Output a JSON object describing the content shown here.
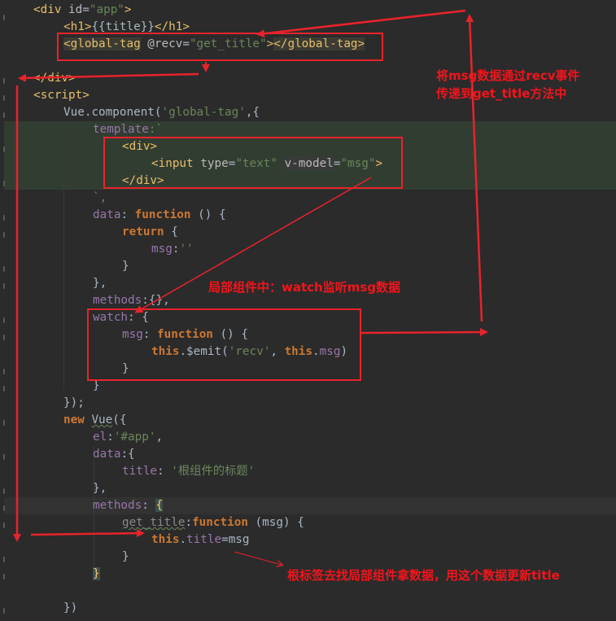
{
  "code": {
    "l1": {
      "open": "<div ",
      "attr": "id",
      "eq": "=",
      "val": "\"app\"",
      "close": ">"
    },
    "l2": {
      "open": "<h1>",
      "txt": "{{title}}",
      "close": "</h1>"
    },
    "l3": {
      "open": "<global-tag",
      "attr": " @recv",
      "eq": "=",
      "val": "\"get_title\"",
      "gt": ">",
      "close": "</global-tag>",
      "gt2": ">"
    },
    "l5": {
      "text": "</div>"
    },
    "l6": {
      "text": "<script>"
    },
    "l7": {
      "obj": "Vue",
      "dot": ".",
      "fn": "component",
      "open": "(",
      "str": "'global-tag'",
      "rest": ",{"
    },
    "l8": {
      "prop": "template",
      "rest": ":`"
    },
    "l9": {
      "tag": "<div>"
    },
    "l10": {
      "open": "<input ",
      "a1": "type",
      "eq1": "=",
      "v1": "\"text\"",
      "sp": " ",
      "a2": "v-model",
      "eq2": "=",
      "v2": "\"msg\"",
      "close": ">"
    },
    "l11": {
      "tag": "</div>"
    },
    "l12": {
      "text": "`,"
    },
    "l13": {
      "prop": "data",
      "colon": ": ",
      "kw": "function",
      "rest": " () {"
    },
    "l14": {
      "kw": "return",
      "rest": " {"
    },
    "l15": {
      "prop": "msg",
      "colon": ":",
      "str": "''"
    },
    "l16": {
      "text": "}"
    },
    "l17": {
      "text": "},"
    },
    "l18": {
      "prop": "methods",
      "rest": ":{},"
    },
    "l19": {
      "prop": "watch",
      "rest": ": {"
    },
    "l20": {
      "prop": "msg",
      "colon": ": ",
      "kw": "function",
      "rest": " () {"
    },
    "l21": {
      "kw1": "this",
      "dot": ".",
      "fn": "$emit",
      "open": "(",
      "str": "'recv'",
      "comma": ", ",
      "kw2": "this",
      "dot2": ".",
      "prop": "msg",
      "close": ")"
    },
    "l22": {
      "text": "}"
    },
    "l23": {
      "text": "}"
    },
    "l24": {
      "text": "});"
    },
    "l25": {
      "kw": "new",
      "sp": " ",
      "obj": "Vue",
      "rest": "({"
    },
    "l26": {
      "prop": "el",
      "colon": ":",
      "str": "'#app'",
      "rest": ","
    },
    "l27": {
      "prop": "data",
      "rest": ":{"
    },
    "l28": {
      "prop": "title",
      "colon": ": ",
      "str": "'根组件的标题'"
    },
    "l29": {
      "text": "},"
    },
    "l30": {
      "prop": "methods",
      "colon": ": ",
      "brace": "{"
    },
    "l31": {
      "fn": "get_title",
      "colon": ":",
      "kw": "function",
      "rest": " (msg) {"
    },
    "l32": {
      "kw": "this",
      "dot": ".",
      "prop": "title",
      "rest": "=msg"
    },
    "l33": {
      "text": "}"
    },
    "l34": {
      "brace": "}"
    },
    "l36": {
      "text": "})"
    }
  },
  "annotations": {
    "a1_line1": "将msg数据通过recv事件",
    "a1_line2": "传递到get_title方法中",
    "a2": "局部组件中：watch监听msg数据",
    "a3": "根标签去找局部组件拿数据，用这个数据更新title"
  },
  "colors": {
    "background": "#2b2b2b",
    "annotation_red": "#e8232b",
    "tag": "#e8bf6a",
    "string": "#6a8759",
    "keyword": "#cc7832",
    "property": "#9876aa",
    "function": "#ffc66d"
  }
}
